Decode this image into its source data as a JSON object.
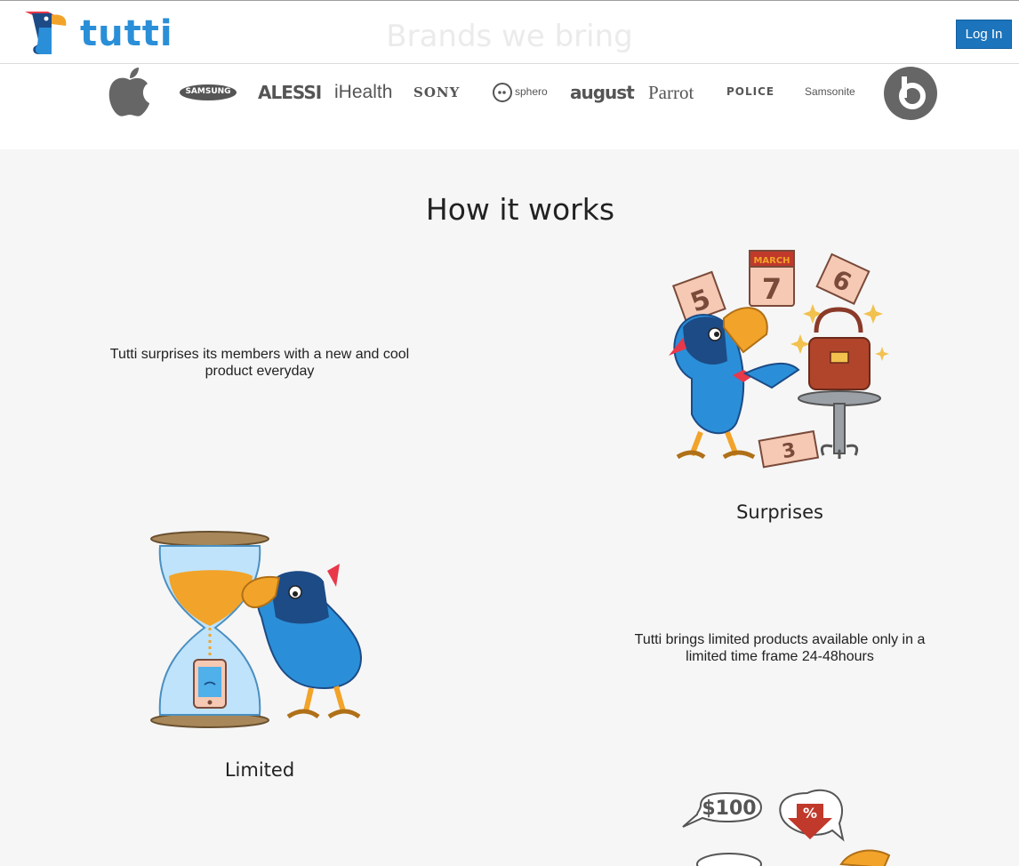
{
  "header": {
    "logo_text": "tutti",
    "brands_title": "Brands we bring",
    "login_label": "Log In"
  },
  "brands": {
    "samsung": "SAMSUNG",
    "alessi": "ALESSI",
    "ihealth": "iHealth",
    "sony": "SONY",
    "sphero": "sphero",
    "august": "august",
    "parrot": "Parrot",
    "police": "POLICE",
    "samsonite": "Samsonite"
  },
  "how_it_works": {
    "title": "How it works",
    "steps": [
      {
        "name": "Surprises",
        "description": "Tutti surprises its members with a new and cool product everyday"
      },
      {
        "name": "Limited",
        "description": "Tutti brings limited products available only in a limited time frame 24-48hours"
      }
    ],
    "calendar_month": "MARCH",
    "calendar_day": "7",
    "tickets": [
      "5",
      "6",
      "3"
    ],
    "price_bubble": "$100",
    "discount_symbol": "%"
  },
  "colors": {
    "login_bg": "#1b74bc",
    "bird_blue": "#2a8fd8",
    "bird_dark": "#1c4b86",
    "beak": "#f2a329",
    "background": "#f6f6f6"
  }
}
